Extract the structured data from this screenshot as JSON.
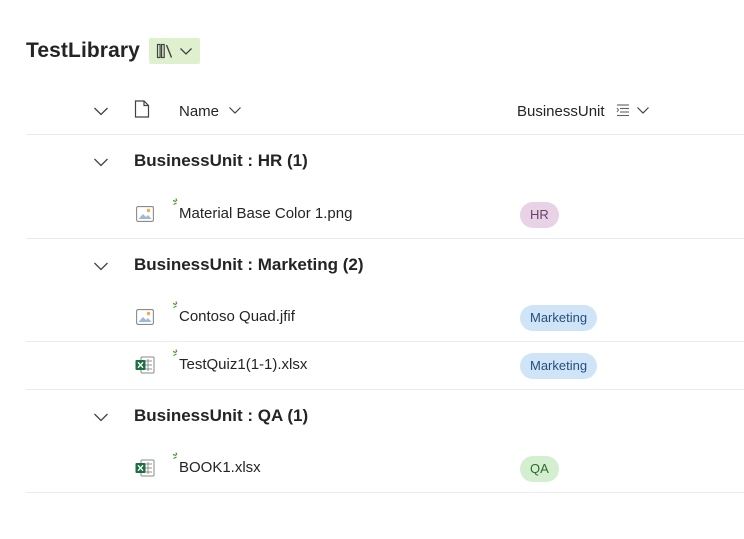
{
  "library": {
    "title": "TestLibrary",
    "view_icon": "library-books-icon",
    "view_chevron_icon": "chevron-down-icon"
  },
  "columns": {
    "select_all_icon": "chevron-down-icon",
    "file_type_icon": "document-icon",
    "name": "Name",
    "business_unit": "BusinessUnit",
    "group_by_icon": "group-list-icon"
  },
  "colors": {
    "hr_badge": "#e8d2e6",
    "marketing_badge": "#d0e4f8",
    "qa_badge": "#d3efd0",
    "view_switch": "#dff0cf",
    "new_indicator": "#4b9c2e",
    "excel_green": "#1d6f42"
  },
  "groups": [
    {
      "label": "BusinessUnit : HR (1)",
      "items": [
        {
          "name": "Material Base Color 1.png",
          "type_icon": "image-file-icon",
          "business_unit": "HR"
        }
      ]
    },
    {
      "label": "BusinessUnit : Marketing (2)",
      "items": [
        {
          "name": "Contoso Quad.jfif",
          "type_icon": "image-file-icon",
          "business_unit": "Marketing"
        },
        {
          "name": "TestQuiz1(1-1).xlsx",
          "type_icon": "excel-file-icon",
          "business_unit": "Marketing"
        }
      ]
    },
    {
      "label": "BusinessUnit : QA (1)",
      "items": [
        {
          "name": "BOOK1.xlsx",
          "type_icon": "excel-file-icon",
          "business_unit": "QA"
        }
      ]
    }
  ]
}
